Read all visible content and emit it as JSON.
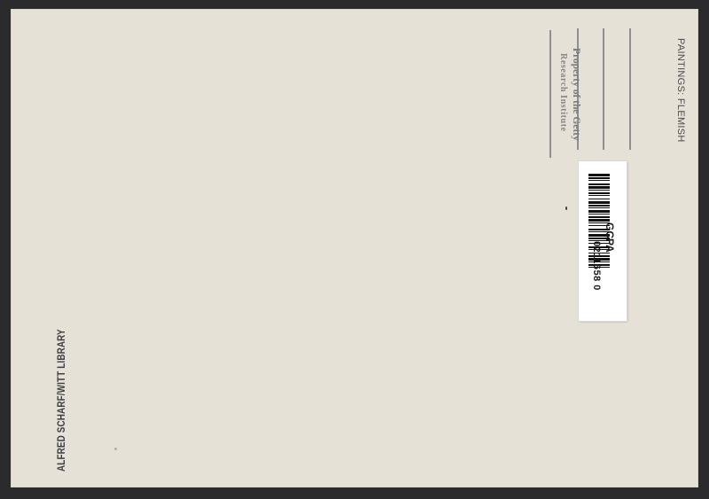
{
  "card": {
    "category": "PAINTINGS: FLEMISH",
    "stamp": {
      "line1": "Property of the Getty",
      "line2": "Research Institute"
    },
    "library": "ALFRED SCHARF/WITT LIBRARY"
  },
  "barcode": {
    "code": "GCPA",
    "number": "0211658 0",
    "bars": [
      3,
      1,
      2,
      1,
      1,
      3,
      2,
      1,
      3,
      1,
      1,
      2,
      2,
      1,
      1,
      3,
      1,
      2,
      3,
      1,
      2,
      1,
      1,
      2,
      3,
      1,
      1,
      2,
      2,
      1,
      3,
      1,
      1,
      2,
      1,
      3,
      2,
      1,
      1,
      2,
      3,
      1,
      2,
      1,
      1,
      2,
      1,
      3,
      2,
      1,
      1,
      3,
      1,
      2,
      2,
      1,
      3,
      1,
      1,
      2,
      2,
      1,
      1,
      3
    ]
  },
  "colors": {
    "card": "#e6e1d6",
    "background": "#2b2b2d",
    "ink": "#3e3e44"
  }
}
